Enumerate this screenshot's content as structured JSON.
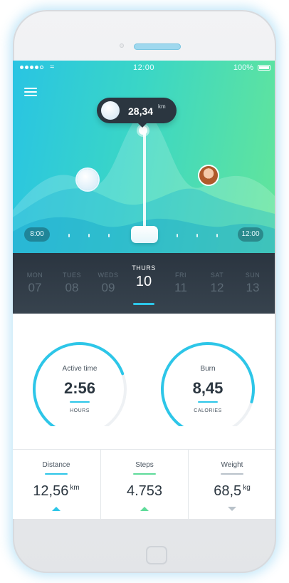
{
  "status_bar": {
    "time": "12:00",
    "battery": "100%"
  },
  "chart": {
    "tooltip_value": "28,34",
    "tooltip_unit": "km",
    "range_start": "8:00",
    "range_end": "12:00"
  },
  "days": [
    {
      "name": "MON",
      "num": "07"
    },
    {
      "name": "TUES",
      "num": "08"
    },
    {
      "name": "WEDS",
      "num": "09"
    },
    {
      "name": "THURS",
      "num": "10",
      "active": true
    },
    {
      "name": "FRI",
      "num": "11"
    },
    {
      "name": "SAT",
      "num": "12"
    },
    {
      "name": "SUN",
      "num": "13"
    }
  ],
  "rings": [
    {
      "title": "Active time",
      "value": "2:56",
      "unit": "HOURS",
      "progress": 0.62,
      "color": "#2dc6e8"
    },
    {
      "title": "Burn",
      "value": "8,45",
      "unit": "CALORIES",
      "progress": 0.72,
      "color": "#2dc6e8"
    }
  ],
  "stats": [
    {
      "label": "Distance",
      "value": "12,56",
      "unit": "km",
      "trend": "up",
      "color": "#2dc6e8"
    },
    {
      "label": "Steps",
      "value": "4.753",
      "unit": "",
      "trend": "up",
      "color": "#5fdb9a"
    },
    {
      "label": "Weight",
      "value": "68,5",
      "unit": "kg",
      "trend": "down",
      "color": "#b9c2ca"
    }
  ],
  "colors": {
    "accent": "#2dc6e8",
    "green": "#5fdb9a",
    "dark": "#2b3640"
  }
}
